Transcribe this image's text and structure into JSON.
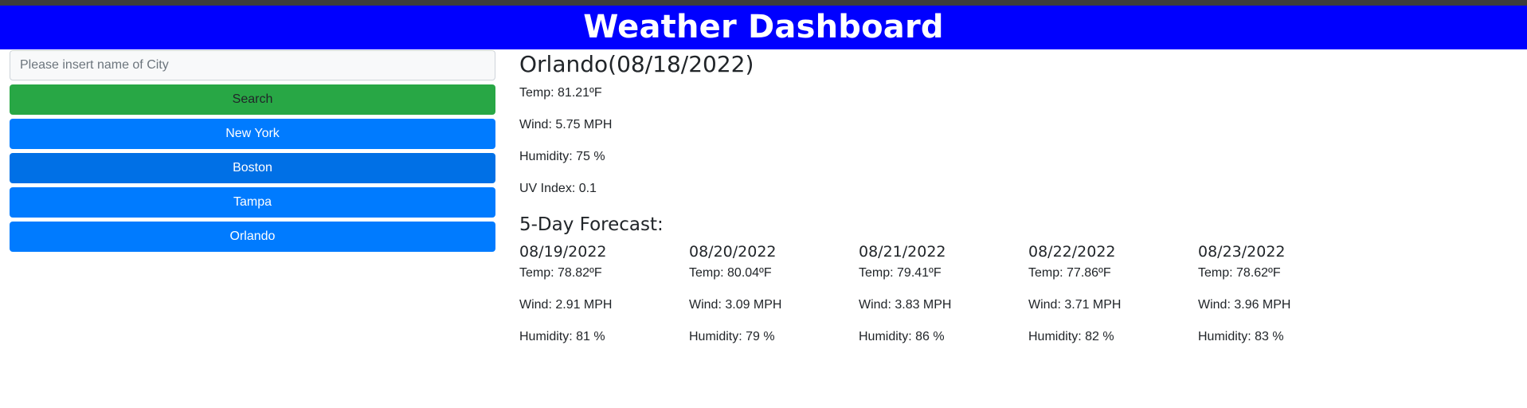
{
  "header": {
    "title": "Weather Dashboard"
  },
  "search": {
    "placeholder": "Please insert name of City",
    "value": "",
    "button_label": "Search"
  },
  "history": [
    {
      "label": "New York"
    },
    {
      "label": "Boston"
    },
    {
      "label": "Tampa"
    },
    {
      "label": "Orlando"
    }
  ],
  "current": {
    "title": "Orlando(08/18/2022)",
    "temp": "Temp: 81.21ºF",
    "wind": "Wind: 5.75 MPH",
    "humidity": "Humidity: 75 %",
    "uv": "UV Index: 0.1"
  },
  "forecast": {
    "title": "5-Day Forecast:",
    "days": [
      {
        "date": "08/19/2022",
        "temp": "Temp: 78.82ºF",
        "wind": "Wind: 2.91 MPH",
        "humidity": "Humidity: 81 %"
      },
      {
        "date": "08/20/2022",
        "temp": "Temp: 80.04ºF",
        "wind": "Wind: 3.09 MPH",
        "humidity": "Humidity: 79 %"
      },
      {
        "date": "08/21/2022",
        "temp": "Temp: 79.41ºF",
        "wind": "Wind: 3.83 MPH",
        "humidity": "Humidity: 86 %"
      },
      {
        "date": "08/22/2022",
        "temp": "Temp: 77.86ºF",
        "wind": "Wind: 3.71 MPH",
        "humidity": "Humidity: 82 %"
      },
      {
        "date": "08/23/2022",
        "temp": "Temp: 78.62ºF",
        "wind": "Wind: 3.96 MPH",
        "humidity": "Humidity: 83 %"
      }
    ]
  },
  "colors": {
    "header_bg": "#0000ff",
    "search_button": "#28a745",
    "city_button": "#007bff"
  }
}
